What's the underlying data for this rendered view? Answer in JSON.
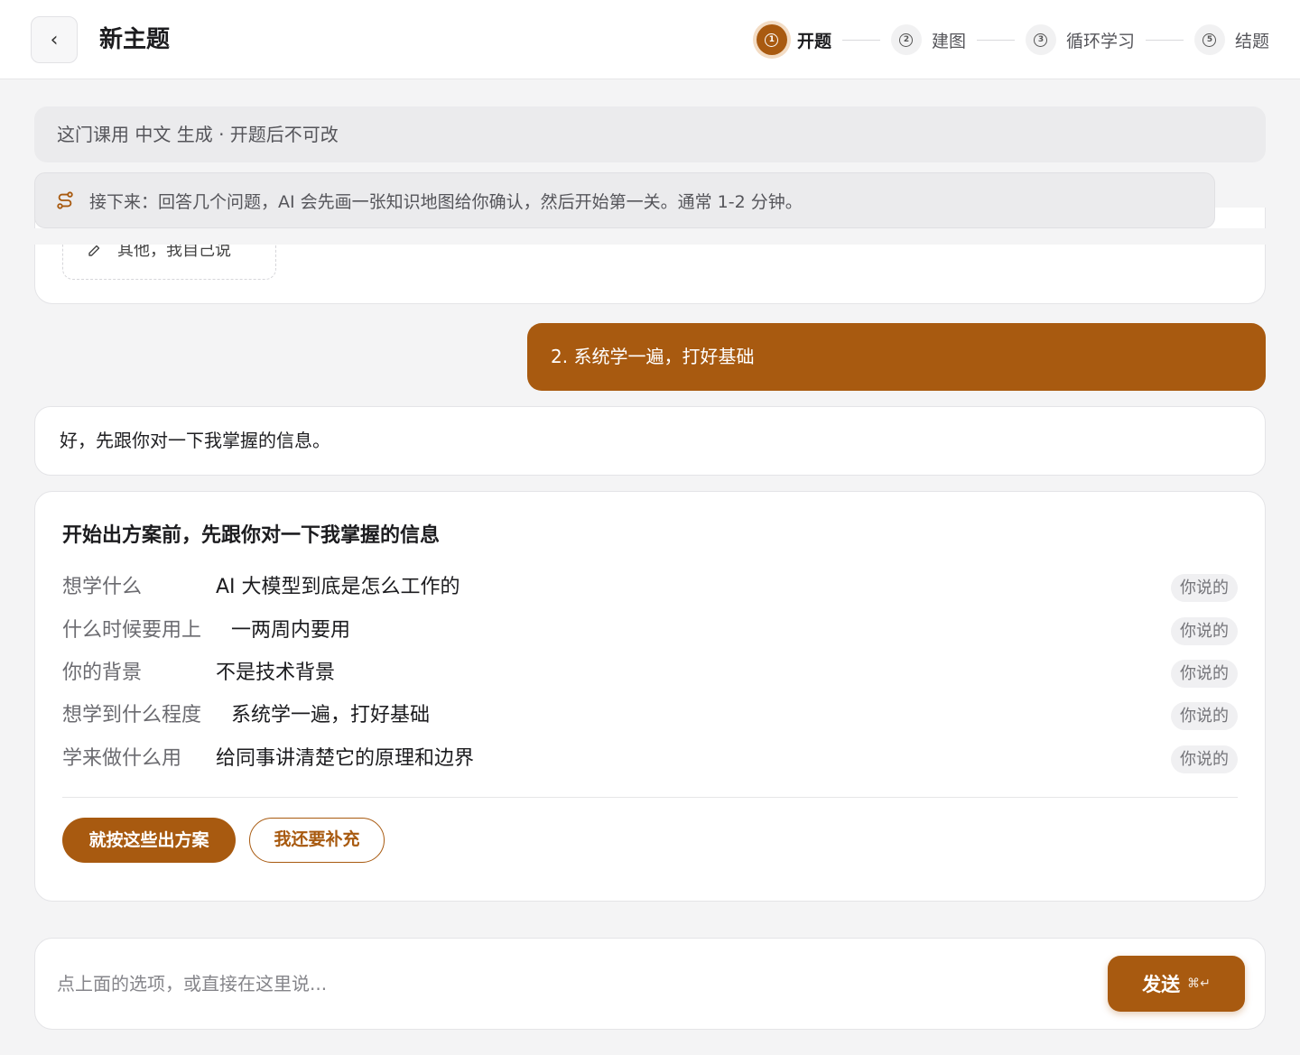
{
  "header": {
    "back_glyph": "‹",
    "title": "新主题",
    "steps": [
      {
        "num": "1",
        "label": "开题",
        "active": true
      },
      {
        "num": "2",
        "label": "建图",
        "active": false
      },
      {
        "num": "3",
        "label": "循环学习",
        "active": false
      },
      {
        "num": "5",
        "label": "结题",
        "active": false
      }
    ]
  },
  "banners": {
    "language": "这门课用 中文 生成 · 开题后不可改",
    "next_steps": "接下来：回答几个问题，AI 会先画一张知识地图给你确认，然后开始第一关。通常 1-2 分钟。"
  },
  "chat": {
    "previous_option": "其他，我自己说",
    "user_message": "2. 系统学一遍，打好基础",
    "ai_reply": "好，先跟你对一下我掌握的信息。",
    "summary": {
      "title": "开始出方案前，先跟你对一下我掌握的信息",
      "rows": [
        {
          "label": "想学什么",
          "value": "AI 大模型到底是怎么工作的",
          "tag": "你说的"
        },
        {
          "label": "什么时候要用上",
          "value": "一两周内要用",
          "tag": "你说的"
        },
        {
          "label": "你的背景",
          "value": "不是技术背景",
          "tag": "你说的"
        },
        {
          "label": "想学到什么程度",
          "value": "系统学一遍，打好基础",
          "tag": "你说的"
        },
        {
          "label": "学来做什么用",
          "value": "给同事讲清楚它的原理和边界",
          "tag": "你说的"
        }
      ],
      "confirm_button": "就按这些出方案",
      "supplement_button": "我还要补充"
    }
  },
  "input": {
    "placeholder": "点上面的选项，或直接在这里说...",
    "value": "",
    "send_label": "发送",
    "shortcut": "⌘↵"
  },
  "colors": {
    "accent": "#a85a10",
    "accent_soft": "#f3dcc4",
    "background": "#f4f4f5",
    "card": "#ffffff"
  },
  "icons": {
    "back": "chevron-left-icon",
    "route": "route-icon",
    "pencil": "pencil-icon",
    "step": "numbered-circle-icon"
  }
}
